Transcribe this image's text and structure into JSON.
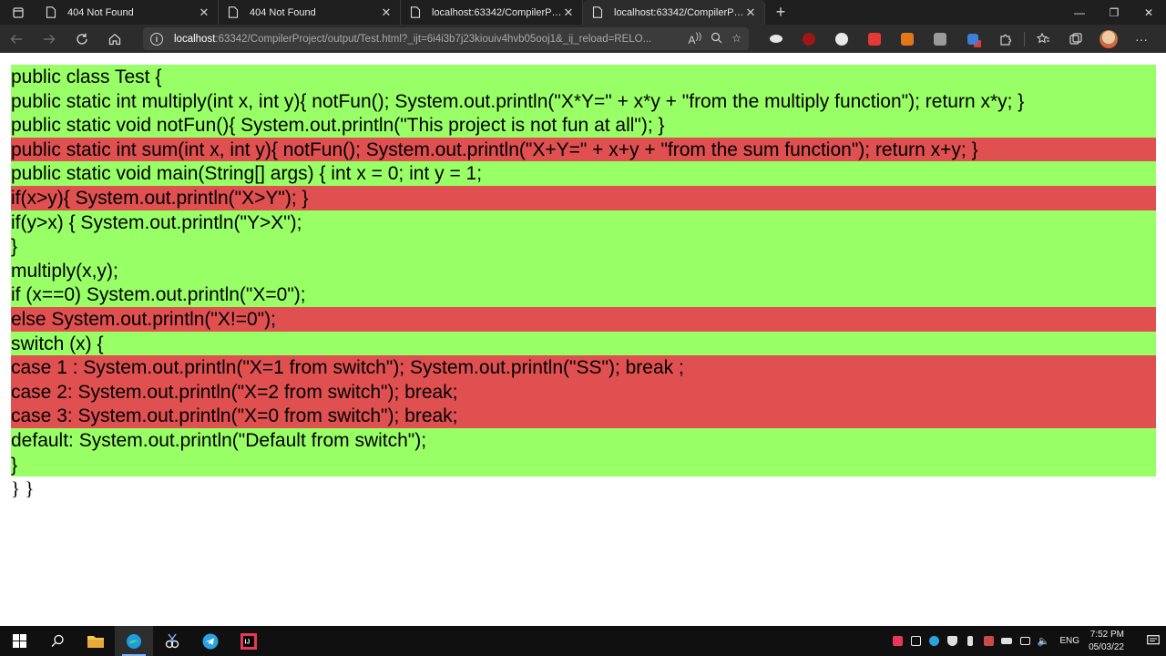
{
  "browser": {
    "tabs": [
      {
        "label": "404 Not Found",
        "active": false
      },
      {
        "label": "404 Not Found",
        "active": false
      },
      {
        "label": "localhost:63342/CompilerProject",
        "active": false
      },
      {
        "label": "localhost:63342/CompilerProject",
        "active": true
      }
    ],
    "new_tab_label": "+",
    "window_controls": {
      "minimize": "—",
      "restore": "❐",
      "close": "✕"
    },
    "address": {
      "host": "localhost",
      "path": ":63342/CompilerProject/output/Test.html?_ijt=6i4i3b7j23kiouiv4hvb05ooj1&_ij_reload=RELO..."
    }
  },
  "code": {
    "lines": [
      {
        "text": "public class Test {",
        "status": "covered"
      },
      {
        "text": "public static int multiply(int x, int y){ notFun(); System.out.println(\"X*Y=\" + x*y + \"from the multiply function\"); return x*y; }",
        "status": "covered"
      },
      {
        "text": "public static void notFun(){ System.out.println(\"This project is not fun at all\"); }",
        "status": "covered"
      },
      {
        "text": "public static int sum(int x, int y){ notFun(); System.out.println(\"X+Y=\" + x+y + \"from the sum function\"); return x+y; }",
        "status": "missed"
      },
      {
        "text": "public static void main(String[] args) { int x = 0; int y = 1;",
        "status": "covered"
      },
      {
        "text": "if(x>y){ System.out.println(\"X>Y\"); }",
        "status": "missed"
      },
      {
        "text": "if(y>x) { System.out.println(\"Y>X\");",
        "status": "covered"
      },
      {
        "text": "}",
        "status": "covered"
      },
      {
        "text": "multiply(x,y);",
        "status": "covered"
      },
      {
        "text": "if (x==0) System.out.println(\"X=0\");",
        "status": "covered"
      },
      {
        "text": "else System.out.println(\"X!=0\");",
        "status": "missed"
      },
      {
        "text": "switch (x) {",
        "status": "covered"
      },
      {
        "text": "case 1 : System.out.println(\"X=1 from switch\"); System.out.println(\"SS\"); break ;",
        "status": "missed"
      },
      {
        "text": "case 2: System.out.println(\"X=2 from switch\"); break;",
        "status": "missed"
      },
      {
        "text": "case 3: System.out.println(\"X=0 from switch\"); break;",
        "status": "missed"
      },
      {
        "text": "default: System.out.println(\"Default from switch\");",
        "status": "covered"
      },
      {
        "text": "}",
        "status": "covered"
      },
      {
        "text": "} }",
        "status": "plain"
      }
    ],
    "colors": {
      "covered": "#99ff66",
      "missed": "#e05050"
    }
  },
  "taskbar": {
    "language": "ENG",
    "time": "7:52 PM",
    "date": "05/03/22"
  }
}
